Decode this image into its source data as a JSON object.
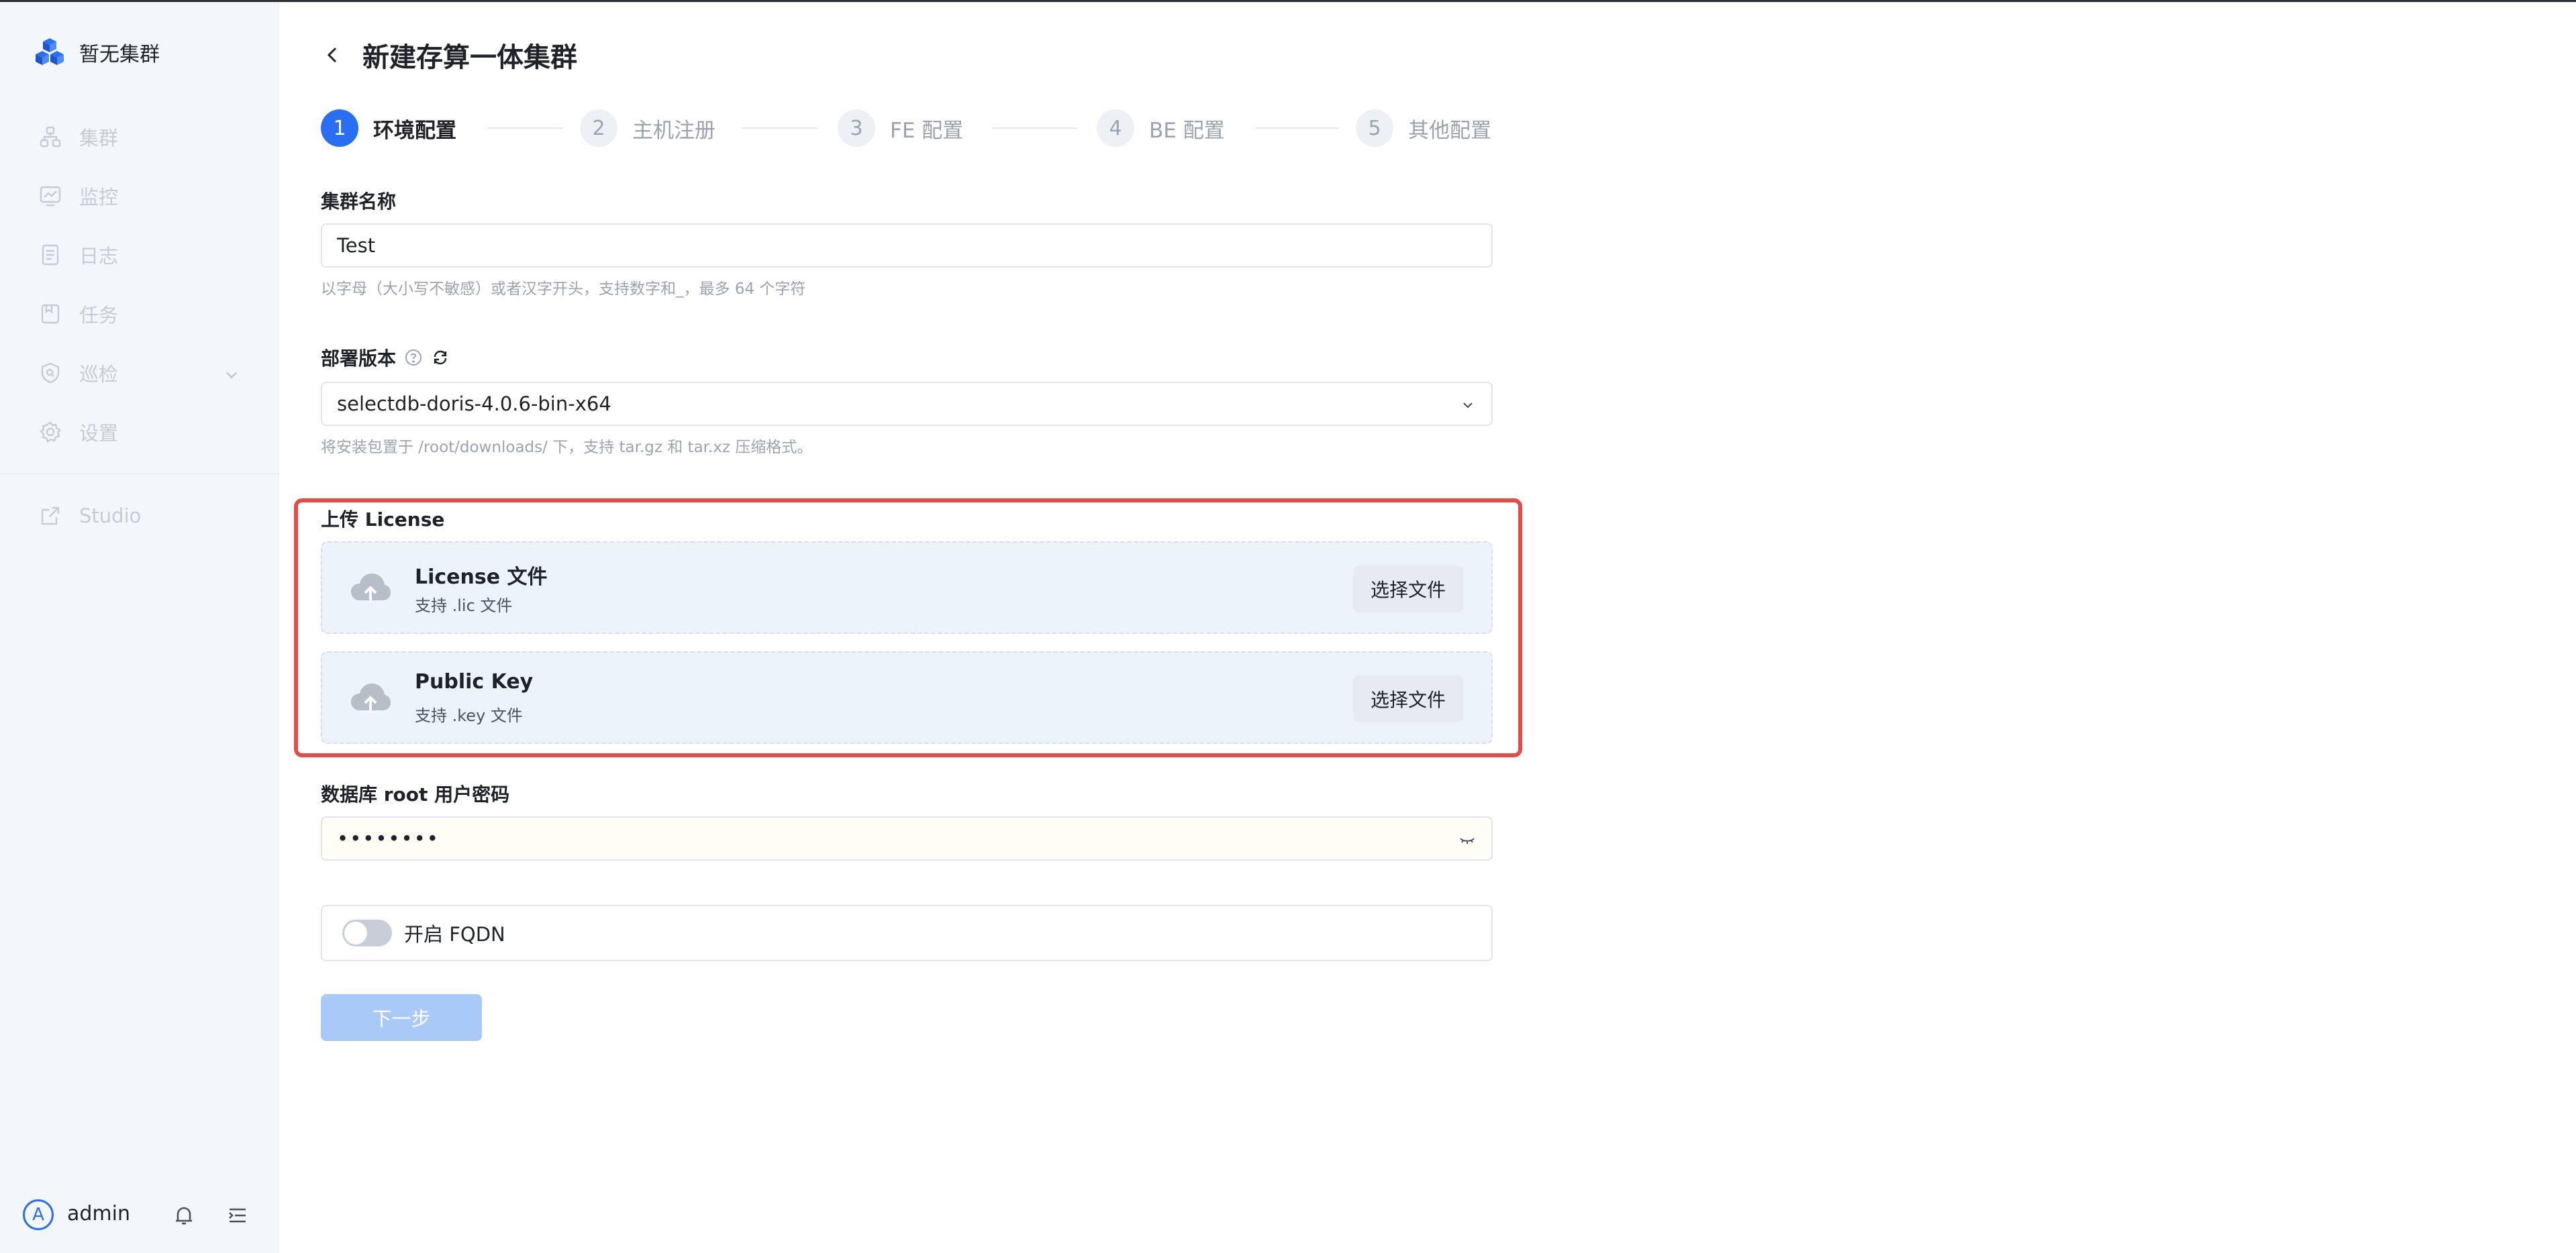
{
  "app": {
    "cluster_name": "暂无集群",
    "brand_color": "#2a6ff2"
  },
  "sidebar": {
    "items": [
      {
        "label": "集群",
        "icon": "cluster-icon"
      },
      {
        "label": "监控",
        "icon": "monitor-icon"
      },
      {
        "label": "日志",
        "icon": "log-icon"
      },
      {
        "label": "任务",
        "icon": "task-icon"
      },
      {
        "label": "巡检",
        "icon": "inspect-icon"
      },
      {
        "label": "设置",
        "icon": "settings-icon"
      }
    ],
    "studio_label": "Studio",
    "user": {
      "avatar_letter": "A",
      "name": "admin"
    }
  },
  "header": {
    "title": "新建存算一体集群"
  },
  "steps": [
    {
      "num": "1",
      "label": "环境配置"
    },
    {
      "num": "2",
      "label": "主机注册"
    },
    {
      "num": "3",
      "label": "FE 配置"
    },
    {
      "num": "4",
      "label": "BE 配置"
    },
    {
      "num": "5",
      "label": "其他配置"
    }
  ],
  "form": {
    "cluster_name_label": "集群名称",
    "cluster_name_value": "Test",
    "cluster_name_hint": "以字母（大小写不敏感）或者汉字开头，支持数字和_，最多 64 个字符",
    "version_label": "部署版本",
    "version_value": "selectdb-doris-4.0.6-bin-x64",
    "version_hint": "将安装包置于 /root/downloads/ 下，支持 tar.gz 和 tar.xz 压缩格式。",
    "license_label": "上传 License",
    "license_card": {
      "title": "License 文件",
      "sub": "支持 .lic 文件",
      "button": "选择文件"
    },
    "key_card": {
      "title": "Public Key",
      "sub": "支持 .key 文件",
      "button": "选择文件"
    },
    "password_label": "数据库 root 用户密码",
    "password_value": "••••••••",
    "fqdn_label": "开启 FQDN",
    "next_label": "下一步"
  }
}
